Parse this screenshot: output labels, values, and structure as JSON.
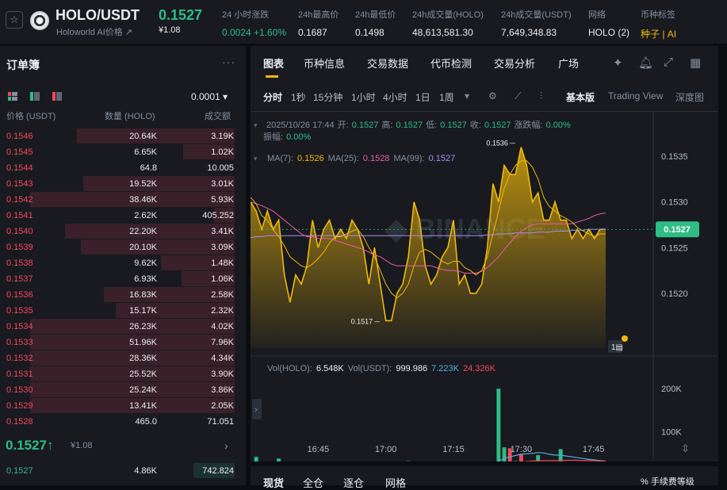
{
  "header": {
    "pair": "HOLO/USDT",
    "subtitle": "Holoworld AI价格 ↗",
    "price": "0.1527",
    "price_cny": "¥1.08",
    "stats": [
      {
        "label": "24 小时涨跌",
        "value": "0.0024 +1.60%",
        "color": "green"
      },
      {
        "label": "24h最高价",
        "value": "0.1687",
        "color": ""
      },
      {
        "label": "24h最低价",
        "value": "0.1498",
        "color": ""
      },
      {
        "label": "24h成交量(HOLO)",
        "value": "48,613,581.30",
        "color": ""
      },
      {
        "label": "24h成交量(USDT)",
        "value": "7,649,348.83",
        "color": ""
      },
      {
        "label": "网络",
        "value": "HOLO (2)",
        "color": ""
      },
      {
        "label": "币种标签",
        "value": "种子 | AI",
        "color": "yellow"
      }
    ]
  },
  "orderbook": {
    "title": "订单簿",
    "tick": "0.0001 ▾",
    "col_price": "价格 (USDT)",
    "col_qty": "数量 (HOLO)",
    "col_total": "成交额",
    "asks": [
      {
        "p": "0.1546",
        "q": "20.64K",
        "t": "3.19K",
        "d": 0.77
      },
      {
        "p": "0.1545",
        "q": "6.65K",
        "t": "1.02K",
        "d": 0.25
      },
      {
        "p": "0.1544",
        "q": "64.8",
        "t": "10.005",
        "d": 0.0
      },
      {
        "p": "0.1543",
        "q": "19.52K",
        "t": "3.01K",
        "d": 0.74
      },
      {
        "p": "0.1542",
        "q": "38.46K",
        "t": "5.93K",
        "d": 1.0
      },
      {
        "p": "0.1541",
        "q": "2.62K",
        "t": "405.252",
        "d": 0.1
      },
      {
        "p": "0.1540",
        "q": "22.20K",
        "t": "3.41K",
        "d": 0.83
      },
      {
        "p": "0.1539",
        "q": "20.10K",
        "t": "3.09K",
        "d": 0.75
      },
      {
        "p": "0.1538",
        "q": "9.62K",
        "t": "1.48K",
        "d": 0.36
      },
      {
        "p": "0.1537",
        "q": "6.93K",
        "t": "1.06K",
        "d": 0.26
      },
      {
        "p": "0.1536",
        "q": "16.83K",
        "t": "2.58K",
        "d": 0.64
      },
      {
        "p": "0.1535",
        "q": "15.17K",
        "t": "2.32K",
        "d": 0.58
      },
      {
        "p": "0.1534",
        "q": "26.23K",
        "t": "4.02K",
        "d": 1.0
      },
      {
        "p": "0.1533",
        "q": "51.96K",
        "t": "7.96K",
        "d": 1.0
      },
      {
        "p": "0.1532",
        "q": "28.36K",
        "t": "4.34K",
        "d": 1.0
      },
      {
        "p": "0.1531",
        "q": "25.52K",
        "t": "3.90K",
        "d": 1.0
      },
      {
        "p": "0.1530",
        "q": "25.24K",
        "t": "3.86K",
        "d": 1.0
      },
      {
        "p": "0.1529",
        "q": "13.41K",
        "t": "2.05K",
        "d": 1.0
      },
      {
        "p": "0.1528",
        "q": "465.0",
        "t": "71.051",
        "d": 0.0
      }
    ],
    "last_price": "0.1527↑",
    "last_cny": "¥1.08",
    "bids": [
      {
        "p": "0.1527",
        "q": "4.86K",
        "t": "742.824",
        "d": 0.2
      }
    ]
  },
  "chart": {
    "tabs": [
      "图表",
      "币种信息",
      "交易数据",
      "代币检测",
      "交易分析",
      "广场"
    ],
    "timeframes": [
      "分时",
      "1秒",
      "15分钟",
      "1小时",
      "4小时",
      "1日",
      "1周"
    ],
    "active_tf": "分时",
    "views": [
      "基本版",
      "Trading View",
      "深度图"
    ],
    "info": "2025/10/26 17:44  开: 0.1527  高: 0.1527  低: 0.1527  收: 0.1527  涨跌幅: 0.00%  振幅: 0.00%",
    "ohlc_line": {
      "date": "2025/10/26 17:44",
      "open_l": "开:",
      "open": "0.1527",
      "high_l": "高:",
      "high": "0.1527",
      "low_l": "低:",
      "low": "0.1527",
      "close_l": "收:",
      "close": "0.1527",
      "chg_l": "涨跌幅:",
      "chg": "0.00%",
      "amp_l": "振幅:",
      "amp": "0.00%"
    },
    "ma": {
      "ma7_l": "MA(7):",
      "ma7": "0.1526",
      "ma25_l": "MA(25):",
      "ma25": "0.1528",
      "ma99_l": "MA(99):",
      "ma99": "0.1527"
    },
    "vol": {
      "l1": "Vol(HOLO):",
      "v1": "6.548K",
      "l2": "Vol(USDT):",
      "v2": "999.986",
      "v3": "7.223K",
      "v4": "24.326K"
    },
    "colors": {
      "line": "#f0b90b",
      "ma7": "#f0b90b",
      "ma25": "#e95ba8",
      "ma99": "#a98cf2",
      "up": "#2ebd85",
      "down": "#f6465d"
    }
  },
  "bottom_tabs": [
    "现货",
    "全仓",
    "逐仓",
    "网格"
  ],
  "bottom_right": "% 手续费等级",
  "chart_data": {
    "type": "line",
    "title": "",
    "x_ticks": [
      "16:45",
      "17:00",
      "17:15",
      "17:30",
      "17:45"
    ],
    "y_ticks": [
      "0.1535",
      "0.1530",
      "0.1525",
      "0.1520"
    ],
    "ylim": [
      0.1514,
      0.1539
    ],
    "current_price": "0.1527",
    "high_marker": "0.1536",
    "low_marker": "0.1517",
    "price": [
      0.153,
      0.1529,
      0.1527,
      0.1529,
      0.1527,
      0.1528,
      0.1522,
      0.1519,
      0.1522,
      0.1521,
      0.1523,
      0.1528,
      0.1525,
      0.1527,
      0.1528,
      0.1526,
      0.1527,
      0.1526,
      0.1528,
      0.1527,
      0.1525,
      0.1521,
      0.1525,
      0.1521,
      0.1517,
      0.1517,
      0.152,
      0.1521,
      0.1524,
      0.153,
      0.1528,
      0.1523,
      0.1521,
      0.1522,
      0.1524,
      0.1525,
      0.1528,
      0.1521,
      0.1522,
      0.152,
      0.152,
      0.1521,
      0.1525,
      0.1532,
      0.153,
      0.1534,
      0.1533,
      0.1533,
      0.1536,
      0.1534,
      0.153,
      0.1531,
      0.1528,
      0.1528,
      0.153,
      0.1528,
      0.1528,
      0.1526,
      0.1527,
      0.1526,
      0.1527,
      0.1526,
      0.1527,
      0.1527
    ],
    "ma7": [
      0.15305,
      0.15298,
      0.15285,
      0.1528,
      0.1527,
      0.15262,
      0.15252,
      0.1524,
      0.15235,
      0.1523,
      0.15228,
      0.15232,
      0.15238,
      0.15245,
      0.15255,
      0.15262,
      0.15262,
      0.15265,
      0.15268,
      0.1527,
      0.15262,
      0.1525,
      0.1524,
      0.15225,
      0.1521,
      0.152,
      0.15195,
      0.152,
      0.1521,
      0.1523,
      0.15245,
      0.15248,
      0.15245,
      0.1524,
      0.15235,
      0.15232,
      0.15235,
      0.15235,
      0.15228,
      0.15225,
      0.1522,
      0.15225,
      0.1524,
      0.15265,
      0.1529,
      0.15315,
      0.1533,
      0.1534,
      0.15345,
      0.15345,
      0.15338,
      0.15325,
      0.15305,
      0.15295,
      0.1529,
      0.15285,
      0.15282,
      0.15278,
      0.15272,
      0.15268,
      0.15265,
      0.15262,
      0.15265,
      0.15265
    ],
    "ma25": [
      0.153,
      0.15298,
      0.15296,
      0.15293,
      0.1529,
      0.15285,
      0.1528,
      0.15275,
      0.1527,
      0.15265,
      0.15262,
      0.15262,
      0.1526,
      0.1526,
      0.1526,
      0.15258,
      0.15256,
      0.15254,
      0.15252,
      0.1525,
      0.15248,
      0.15245,
      0.15242,
      0.1524,
      0.15236,
      0.15232,
      0.1523,
      0.1523,
      0.1523,
      0.1523,
      0.1523,
      0.1523,
      0.1523,
      0.15228,
      0.15226,
      0.15225,
      0.15225,
      0.15224,
      0.15222,
      0.15222,
      0.15222,
      0.15224,
      0.15228,
      0.15234,
      0.1524,
      0.15248,
      0.15255,
      0.15262,
      0.15268,
      0.15272,
      0.15275,
      0.15276,
      0.15276,
      0.15276,
      0.15276,
      0.15276,
      0.15276,
      0.15276,
      0.15278,
      0.1528,
      0.15282,
      0.15285,
      0.15287,
      0.15288
    ],
    "ma99": [
      0.15261,
      0.15262,
      0.15262,
      0.15263,
      0.15263,
      0.15263,
      0.15263,
      0.15263,
      0.15263,
      0.15263,
      0.15263,
      0.15263,
      0.15263,
      0.15263,
      0.15263,
      0.15263,
      0.15263,
      0.15263,
      0.15263,
      0.15263,
      0.15263,
      0.15263,
      0.15263,
      0.15263,
      0.15263,
      0.15263,
      0.15263,
      0.15263,
      0.15263,
      0.15263,
      0.15263,
      0.15263,
      0.15263,
      0.15263,
      0.15263,
      0.15263,
      0.15263,
      0.15263,
      0.15263,
      0.15263,
      0.15263,
      0.15263,
      0.15264,
      0.15264,
      0.15265,
      0.15265,
      0.15265,
      0.15266,
      0.15266,
      0.15266,
      0.15266,
      0.15267,
      0.15267,
      0.15267,
      0.15268,
      0.15268,
      0.15268,
      0.15269,
      0.15269,
      0.15269,
      0.1527,
      0.1527,
      0.1527,
      0.1527
    ],
    "vol_ticks": [
      "200K",
      "100K"
    ],
    "vol_max": 250,
    "volume": [
      18,
      42,
      12,
      10,
      8,
      38,
      14,
      10,
      12,
      8,
      10,
      6,
      28,
      16,
      12,
      9,
      14,
      8,
      10,
      12,
      20,
      16,
      28,
      22,
      30,
      8,
      12,
      18,
      32,
      30,
      24,
      22,
      14,
      12,
      26,
      20,
      16,
      10,
      12,
      12,
      8,
      10,
      22,
      30,
      200,
      64,
      62,
      32,
      48,
      30,
      28,
      46,
      24,
      12,
      20,
      60,
      24,
      12,
      14,
      10,
      8,
      12,
      10,
      7
    ],
    "vol_up": [
      0,
      1,
      0,
      0,
      0,
      1,
      0,
      1,
      0,
      1,
      0,
      1,
      0,
      1,
      0,
      1,
      1,
      1,
      0,
      1,
      0,
      1,
      0,
      1,
      0,
      1,
      1,
      0,
      1,
      1,
      0,
      0,
      1,
      0,
      1,
      0,
      1,
      0,
      1,
      1,
      0,
      1,
      1,
      1,
      1,
      1,
      0,
      1,
      0,
      1,
      0,
      1,
      0,
      0,
      1,
      1,
      0,
      1,
      0,
      1,
      0,
      1,
      0,
      1
    ],
    "vol_ma1": [
      20,
      20,
      19,
      19,
      18,
      18,
      17,
      17,
      16,
      16,
      15,
      15,
      16,
      16,
      16,
      15,
      15,
      14,
      14,
      14,
      15,
      15,
      16,
      17,
      18,
      18,
      18,
      19,
      20,
      22,
      23,
      24,
      24,
      23,
      22,
      22,
      21,
      20,
      19,
      18,
      17,
      16,
      16,
      18,
      32,
      38,
      42,
      45,
      48,
      49,
      50,
      52,
      51,
      48,
      46,
      46,
      44,
      42,
      40,
      38,
      36,
      35,
      33,
      32
    ],
    "vol_ma2": [
      22,
      22,
      22,
      21,
      21,
      21,
      20,
      20,
      20,
      19,
      19,
      19,
      19,
      19,
      19,
      18,
      18,
      18,
      18,
      18,
      18,
      18,
      18,
      18,
      19,
      19,
      19,
      19,
      19,
      20,
      20,
      21,
      21,
      21,
      21,
      21,
      21,
      21,
      20,
      20,
      20,
      20,
      20,
      21,
      24,
      26,
      28,
      29,
      30,
      31,
      32,
      33,
      33,
      33,
      33,
      33,
      34,
      34,
      34,
      33,
      33,
      33,
      32,
      32
    ]
  }
}
